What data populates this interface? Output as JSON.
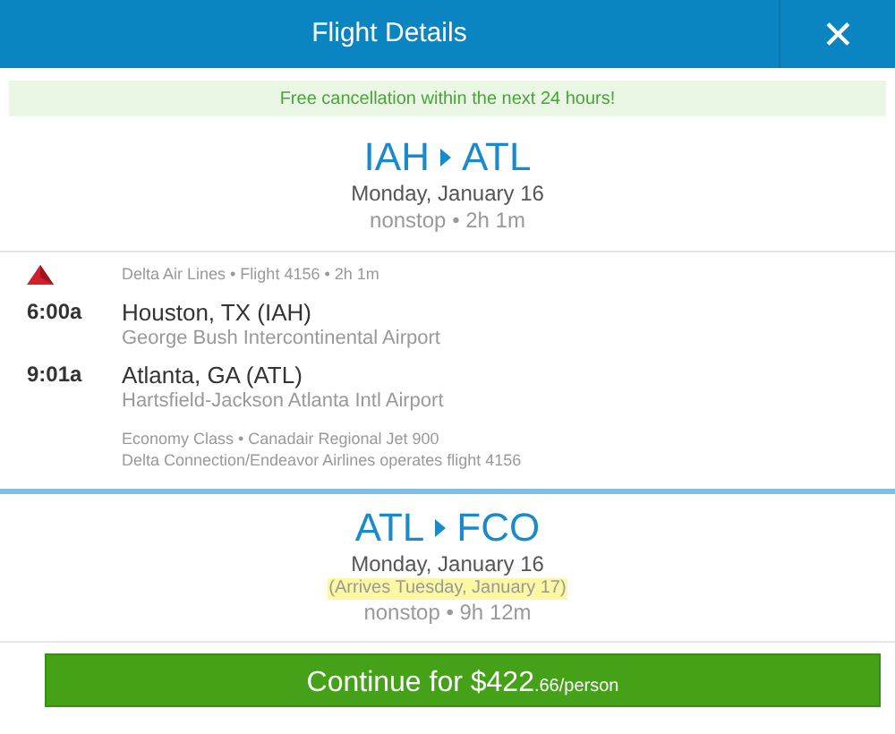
{
  "header": {
    "title": "Flight Details",
    "close": "✕"
  },
  "notice": "Free cancellation within the next 24 hours!",
  "legs": [
    {
      "origin": "IAH",
      "destination": "ATL",
      "date": "Monday, January 16",
      "summary": "nonstop • 2h 1m",
      "segment": {
        "info": "Delta Air Lines • Flight 4156 • 2h 1m",
        "stops": [
          {
            "time": "6:00a",
            "city": "Houston, TX (IAH)",
            "airport": "George Bush Intercontinental Airport"
          },
          {
            "time": "9:01a",
            "city": "Atlanta, GA (ATL)",
            "airport": "Hartsfield-Jackson Atlanta Intl Airport"
          }
        ],
        "notes": [
          "Economy Class • Canadair Regional Jet 900",
          "Delta Connection/Endeavor Airlines operates flight 4156"
        ]
      }
    },
    {
      "origin": "ATL",
      "destination": "FCO",
      "date": "Monday, January 16",
      "arrival_note": "(Arrives Tuesday, January 17)",
      "summary": "nonstop • 9h 12m"
    }
  ],
  "continue_button": {
    "label": "Continue for $422",
    "suffix": ".66/person"
  }
}
